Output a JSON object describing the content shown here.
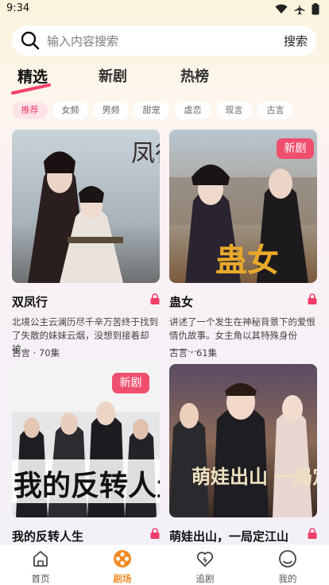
{
  "status": {
    "time": "9:34"
  },
  "search": {
    "placeholder": "输入内容搜索",
    "button": "搜索"
  },
  "tabs": [
    {
      "label": "精选",
      "active": true
    },
    {
      "label": "新剧",
      "active": false
    },
    {
      "label": "热榜",
      "active": false
    }
  ],
  "chips": [
    "推荐",
    "女频",
    "男频",
    "甜宠",
    "虐恋",
    "现言",
    "古言"
  ],
  "cards": [
    {
      "title": "双凤行",
      "desc": "北境公主云澜历尽千辛万苦终于找到了失散的妹妹云烟，没想到接着却被…",
      "meta": "古言 · 70集",
      "badge": "",
      "poster_text": "凤行"
    },
    {
      "title": "蛊女",
      "desc": "讲述了一个发生在神秘背景下的爱恨情仇故事。女主角以其特殊身份——…",
      "meta": "古言 · 61集",
      "badge": "新剧",
      "poster_text": "蛊女"
    },
    {
      "title": "我的反转人生",
      "desc": "",
      "meta": "",
      "badge": "新剧",
      "poster_text": "我的反转人生"
    },
    {
      "title": "萌娃出山，一局定江山",
      "desc": "",
      "meta": "",
      "badge": "",
      "poster_text": "萌娃出山 一局定江山"
    }
  ],
  "nav": [
    {
      "label": "首页",
      "icon": "home-icon"
    },
    {
      "label": "剧场",
      "icon": "film-reel-icon",
      "active": true
    },
    {
      "label": "追剧",
      "icon": "heart-icon"
    },
    {
      "label": "我的",
      "icon": "profile-icon"
    }
  ],
  "colors": {
    "accent": "#ef4f6e",
    "nav_active": "#f08a25"
  }
}
